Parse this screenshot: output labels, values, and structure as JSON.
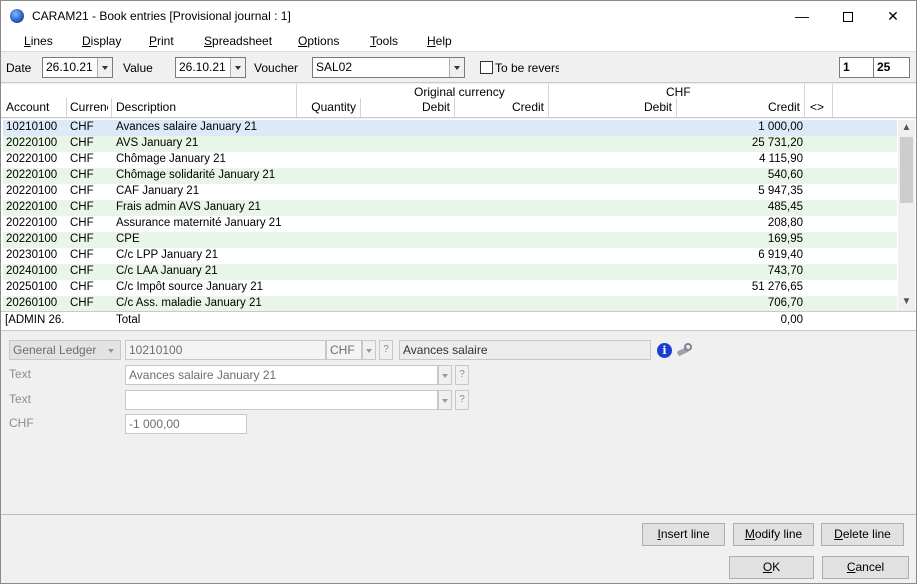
{
  "window": {
    "title": "CARAM21 - Book entries [Provisional journal : 1]",
    "controls": {
      "minimize": "—",
      "close": "✕"
    }
  },
  "menu": [
    "Lines",
    "Display",
    "Print",
    "Spreadsheet",
    "Options",
    "Tools",
    "Help"
  ],
  "header": {
    "date_label": "Date",
    "date_value": "26.10.21",
    "value_label": "Value",
    "value_value": "26.10.21",
    "voucher_label": "Voucher",
    "voucher_value": "SAL02",
    "reverse_label": "To be reverse",
    "reverse_checked": false,
    "page_current": "1",
    "page_total": "25"
  },
  "columns": {
    "account": "Account",
    "currency": "Currenc",
    "description": "Description",
    "quantity": "Quantity",
    "group_original": "Original currency",
    "orig_debit": "Debit",
    "orig_credit": "Credit",
    "group_chf": "CHF",
    "chf_debit": "Debit",
    "chf_credit": "Credit",
    "swap": "<>"
  },
  "rows": [
    {
      "account": "10210100",
      "currency": "CHF",
      "description": "Avances salaire January 21",
      "credit": "1 000,00"
    },
    {
      "account": "20220100",
      "currency": "CHF",
      "description": "AVS January 21",
      "credit": "25 731,20"
    },
    {
      "account": "20220100",
      "currency": "CHF",
      "description": "Chômage January 21",
      "credit": "4 115,90"
    },
    {
      "account": "20220100",
      "currency": "CHF",
      "description": "Chômage solidarité January 21",
      "credit": "540,60"
    },
    {
      "account": "20220100",
      "currency": "CHF",
      "description": "CAF January 21",
      "credit": "5 947,35"
    },
    {
      "account": "20220100",
      "currency": "CHF",
      "description": "Frais admin AVS January 21",
      "credit": "485,45"
    },
    {
      "account": "20220100",
      "currency": "CHF",
      "description": "Assurance maternité January 21",
      "credit": "208,80"
    },
    {
      "account": "20220100",
      "currency": "CHF",
      "description": "CPE",
      "credit": "169,95"
    },
    {
      "account": "20230100",
      "currency": "CHF",
      "description": "C/c LPP January 21",
      "credit": "6 919,40"
    },
    {
      "account": "20240100",
      "currency": "CHF",
      "description": "C/c LAA January 21",
      "credit": "743,70"
    },
    {
      "account": "20250100",
      "currency": "CHF",
      "description": "C/c Impôt source January 21",
      "credit": "51 276,65"
    },
    {
      "account": "20260100",
      "currency": "CHF",
      "description": "C/c Ass. maladie January 21",
      "credit": "706,70"
    }
  ],
  "total": {
    "user": "[ADMIN  26.",
    "label": "Total",
    "value": "0,00"
  },
  "detail": {
    "ledger": "General Ledger",
    "account": "10210100",
    "currency": "CHF",
    "account_name": "Avances salaire",
    "text1_label": "Text",
    "text1_value": "Avances salaire January 21",
    "text2_label": "Text",
    "text2_value": "",
    "amount_label": "CHF",
    "amount_value": "-1 000,00",
    "help_glyph": "?"
  },
  "buttons": {
    "insert": "Insert line",
    "modify": "Modify line",
    "delete": "Delete line",
    "ok": "OK",
    "cancel": "Cancel"
  }
}
